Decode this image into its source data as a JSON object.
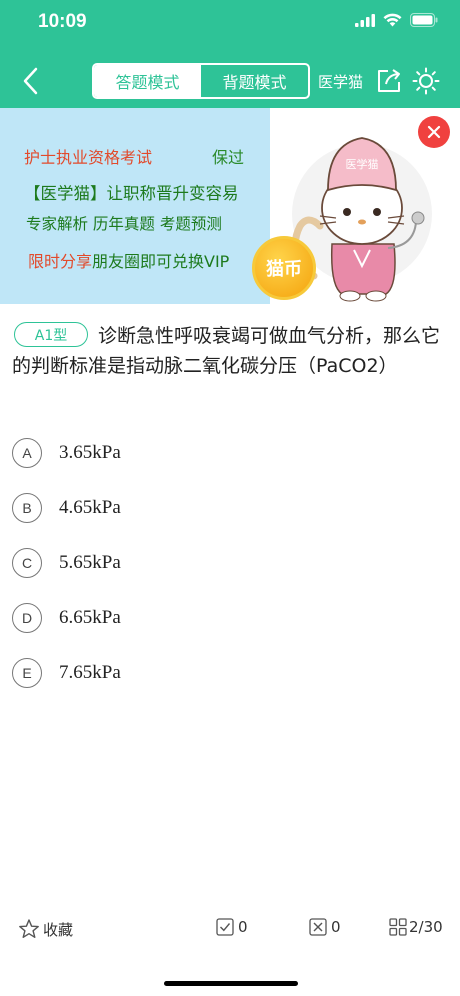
{
  "status_bar": {
    "time": "10:09"
  },
  "header": {
    "mode_answer": "答题模式",
    "mode_recite": "背题模式",
    "brand": "医学猫",
    "colors": {
      "primary": "#2ec397"
    }
  },
  "banner": {
    "line1_left": "护士执业资格考试",
    "line1_right": "保过",
    "line2": "【医学猫】让职称晋升变容易",
    "line3": "专家解析 历年真题 考题预测",
    "line4_red": "限时分享",
    "line4_rest": "朋友圈即可兑换VIP",
    "coin_label": "猫币",
    "cat_hat_label": "医学猫",
    "close_icon": "close-icon"
  },
  "question": {
    "type": "A1型",
    "text": "诊断急性呼吸衰竭可做血气分析，那么它的判断标准是指动脉二氧化碳分压（PaCO2）",
    "options": [
      {
        "letter": "A",
        "text": "3.65kPa"
      },
      {
        "letter": "B",
        "text": "4.65kPa"
      },
      {
        "letter": "C",
        "text": "5.65kPa"
      },
      {
        "letter": "D",
        "text": "6.65kPa"
      },
      {
        "letter": "E",
        "text": "7.65kPa"
      }
    ]
  },
  "bottom_bar": {
    "favorite": "收藏",
    "correct_count": "0",
    "wrong_count": "0",
    "progress": "2/30"
  }
}
